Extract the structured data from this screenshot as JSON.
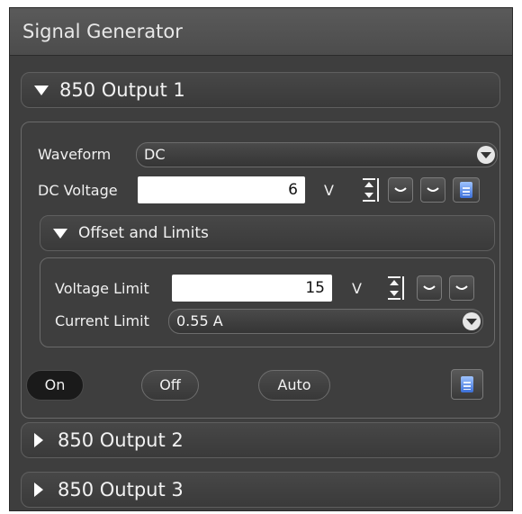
{
  "panel": {
    "title": "Signal Generator"
  },
  "output1": {
    "header": "850 Output 1",
    "waveform_label": "Waveform",
    "waveform_value": "DC",
    "dc_voltage_label": "DC Voltage",
    "dc_voltage_value": "6",
    "dc_voltage_unit": "V",
    "offset_limits": {
      "header": "Offset and Limits",
      "voltage_limit_label": "Voltage Limit",
      "voltage_limit_value": "15",
      "voltage_limit_unit": "V",
      "current_limit_label": "Current Limit",
      "current_limit_value": "0.55 A"
    },
    "buttons": {
      "on": "On",
      "off": "Off",
      "auto": "Auto"
    }
  },
  "output2": {
    "header": "850 Output 2"
  },
  "output3": {
    "header": "850 Output 3"
  },
  "icons": [
    "chevron-down-icon",
    "chevron-right-icon",
    "stepper-icon",
    "decrease-icon",
    "increase-icon",
    "calculator-icon"
  ]
}
